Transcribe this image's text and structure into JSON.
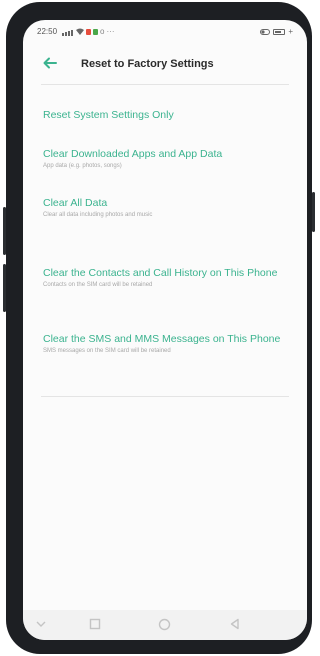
{
  "status_bar": {
    "time": "22:50",
    "network_icons": [
      "wifi-icon",
      "app-notification-icons",
      "more-icon"
    ],
    "right_icons": [
      "toggle-icon",
      "battery-icon"
    ]
  },
  "header": {
    "title": "Reset to Factory Settings",
    "back_icon": "back-arrow-icon"
  },
  "options": [
    {
      "label": "Reset System Settings Only",
      "description": ""
    },
    {
      "label": "Clear Downloaded Apps and App Data",
      "description": "App data (e.g. photos, songs)"
    },
    {
      "label": "Clear All Data",
      "description": "Clear all data including photos and music"
    },
    {
      "label": "Clear the Contacts and Call History on This Phone",
      "description": "Contacts on the SIM card will be retained"
    },
    {
      "label": "Clear the SMS and MMS Messages on This Phone",
      "description": "SMS messages on the SIM card will be retained"
    }
  ],
  "nav_bar": {
    "icons": [
      "menu-icon",
      "home-icon",
      "back-icon"
    ]
  },
  "colors": {
    "accent": "#3bb38f",
    "frame": "#1d1f23",
    "screen": "#fbfbfb"
  }
}
